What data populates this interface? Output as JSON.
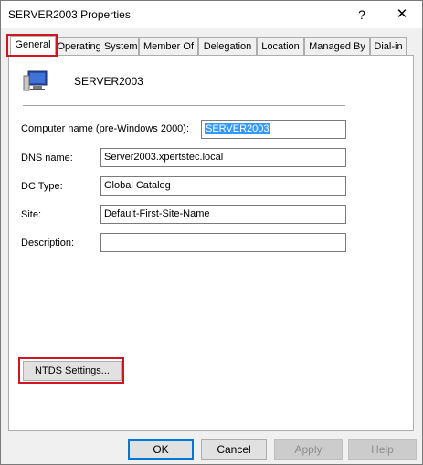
{
  "window": {
    "title": "SERVER2003 Properties",
    "help_glyph": "?",
    "close_glyph": "✕"
  },
  "tabs": [
    {
      "label": "General",
      "active": true
    },
    {
      "label": "Operating System"
    },
    {
      "label": "Member Of"
    },
    {
      "label": "Delegation"
    },
    {
      "label": "Location"
    },
    {
      "label": "Managed By"
    },
    {
      "label": "Dial-in"
    }
  ],
  "general": {
    "icon": "computer-icon",
    "computer_name_display": "SERVER2003",
    "fields": [
      {
        "label": "Computer name (pre-Windows 2000):",
        "value": "SERVER2003",
        "selected": true
      },
      {
        "label": "DNS name:",
        "value": "Server2003.xpertstec.local"
      },
      {
        "label": "DC Type:",
        "value": "Global Catalog"
      },
      {
        "label": "Site:",
        "value": "Default-First-Site-Name"
      },
      {
        "label": "Description:",
        "value": ""
      }
    ],
    "ntds_button": "NTDS Settings..."
  },
  "footer": {
    "ok": "OK",
    "cancel": "Cancel",
    "apply": "Apply",
    "help": "Help"
  },
  "colors": {
    "highlight_box": "#d1161f",
    "selection": "#3399ff",
    "default_button_border": "#0078d7"
  }
}
